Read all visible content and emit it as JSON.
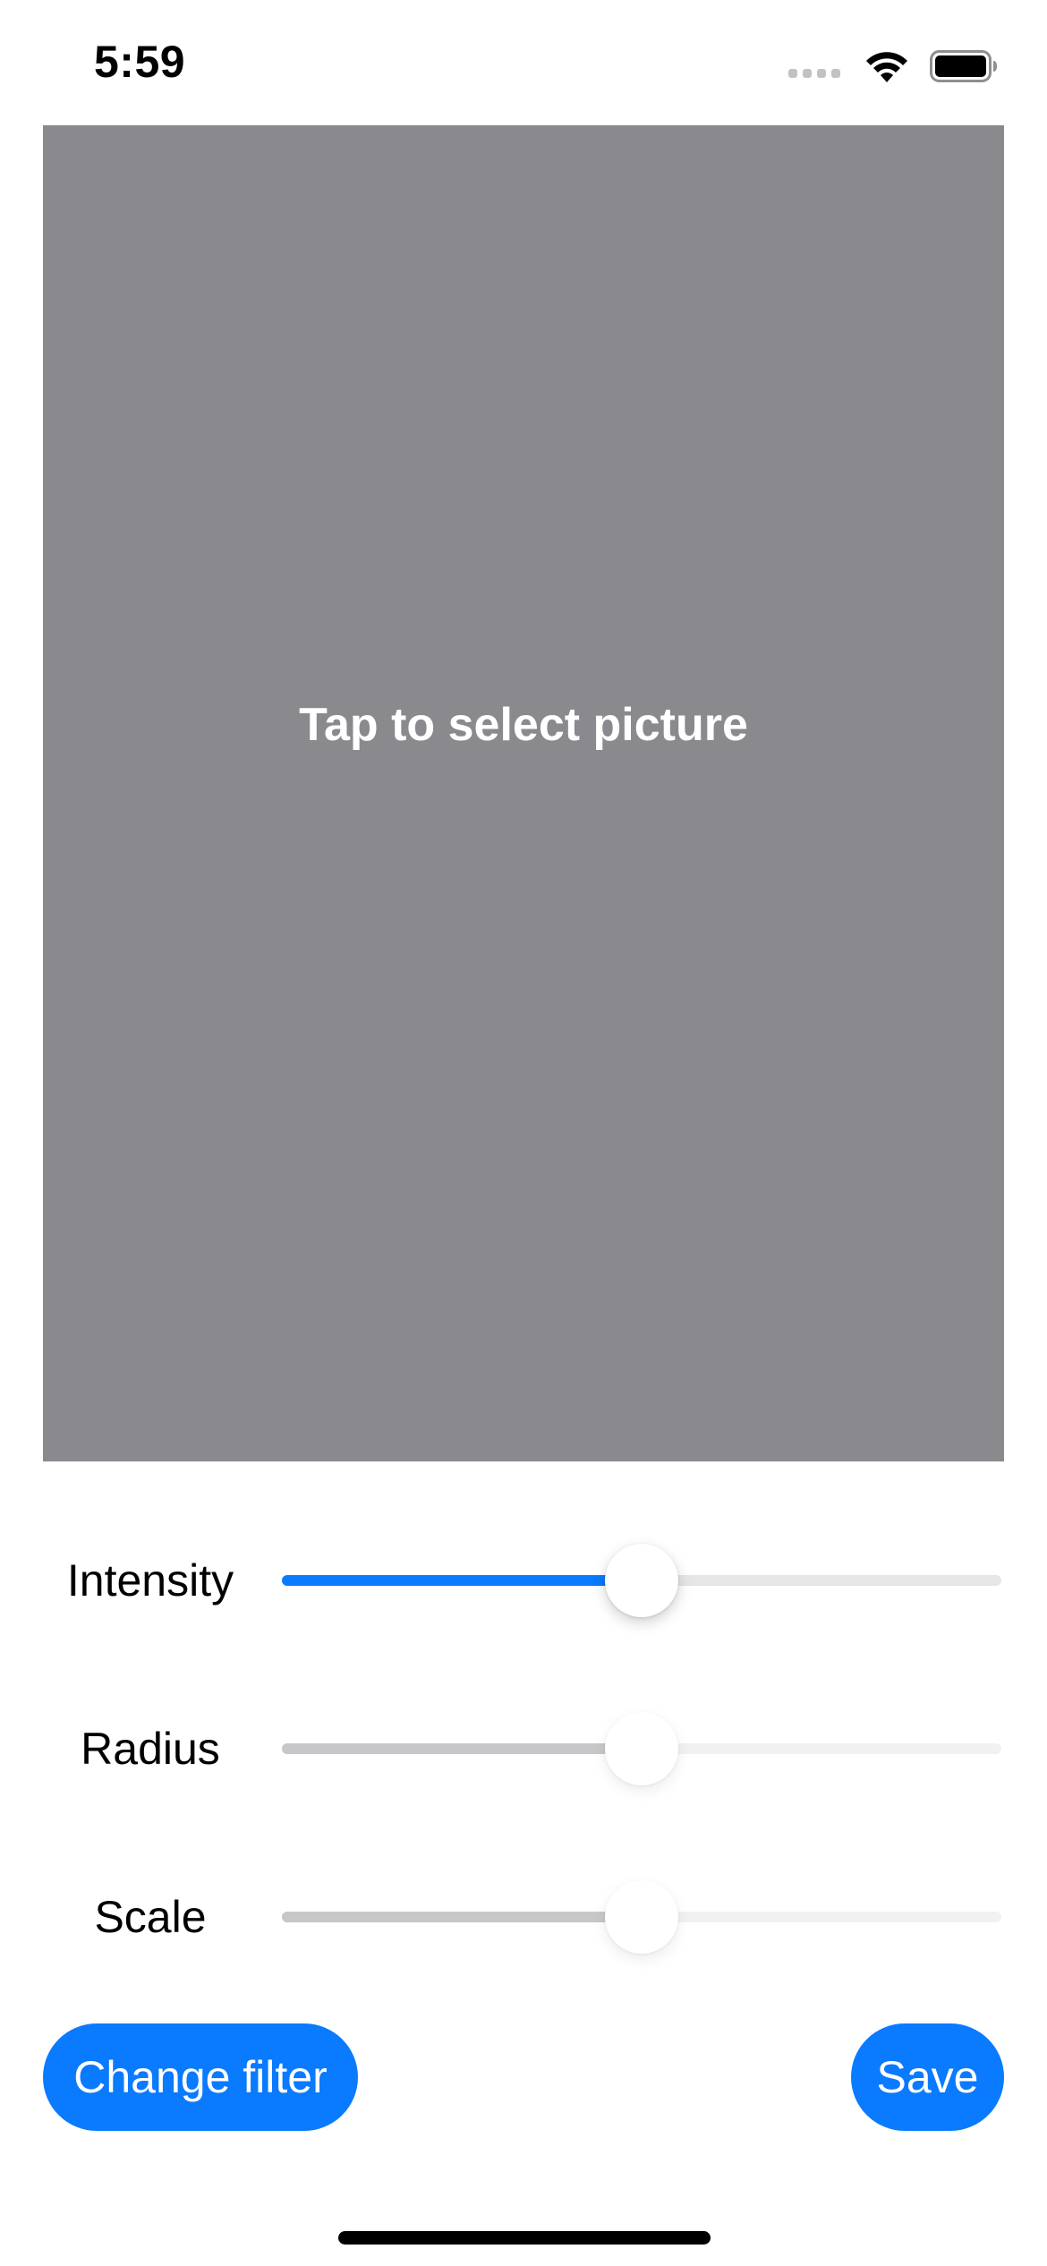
{
  "status_bar": {
    "time": "5:59",
    "icons": [
      "cellular-signal-icon",
      "wifi-icon",
      "battery-icon"
    ]
  },
  "picture": {
    "placeholder_text": "Tap to select picture"
  },
  "controls": {
    "sliders": [
      {
        "label": "Intensity",
        "value": 0.5,
        "enabled": true
      },
      {
        "label": "Radius",
        "value": 0.5,
        "enabled": false
      },
      {
        "label": "Scale",
        "value": 0.5,
        "enabled": false
      }
    ]
  },
  "buttons": {
    "change_filter": "Change filter",
    "save": "Save"
  },
  "colors": {
    "accent": "#0A7AFF",
    "placeholder_bg": "#8A898E"
  }
}
